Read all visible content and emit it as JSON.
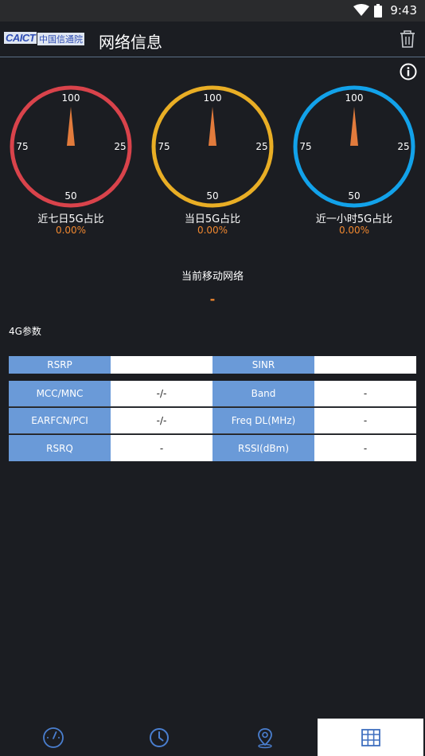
{
  "status_bar": {
    "time": "9:43"
  },
  "app_bar": {
    "logo_text": "CAICT",
    "logo_org": "中国信通院",
    "title": "网络信息"
  },
  "gauges": [
    {
      "label": "近七日5G占比",
      "value": "0.00%",
      "color": "#d9434b",
      "ticks": {
        "top": "100",
        "right": "25",
        "bottom": "50",
        "left": "75"
      }
    },
    {
      "label": "当日5G占比",
      "value": "0.00%",
      "color": "#e9ae25",
      "ticks": {
        "top": "100",
        "right": "25",
        "bottom": "50",
        "left": "75"
      }
    },
    {
      "label": "近一小时5G占比",
      "value": "0.00%",
      "color": "#12a2ea",
      "ticks": {
        "top": "100",
        "right": "25",
        "bottom": "50",
        "left": "75"
      }
    }
  ],
  "network": {
    "title": "当前移动网络",
    "value": "-"
  },
  "section": {
    "title": "4G参数"
  },
  "table": {
    "top_row": {
      "k1": "RSRP",
      "v1": "",
      "k2": "SINR",
      "v2": ""
    },
    "rows": [
      {
        "k1": "MCC/MNC",
        "v1": "-/-",
        "k2": "Band",
        "v2": "-"
      },
      {
        "k1": "EARFCN/PCI",
        "v1": "-/-",
        "k2": "Freq DL(MHz)",
        "v2": "-"
      },
      {
        "k1": "RSRQ",
        "v1": "-",
        "k2": "RSSI(dBm)",
        "v2": "-"
      }
    ]
  },
  "bottom_nav": {
    "items": [
      {
        "icon": "speedometer-icon"
      },
      {
        "icon": "clock-icon"
      },
      {
        "icon": "location-pin-icon"
      },
      {
        "icon": "table-grid-icon",
        "active": true
      }
    ],
    "accent": "#4a7fd0"
  }
}
